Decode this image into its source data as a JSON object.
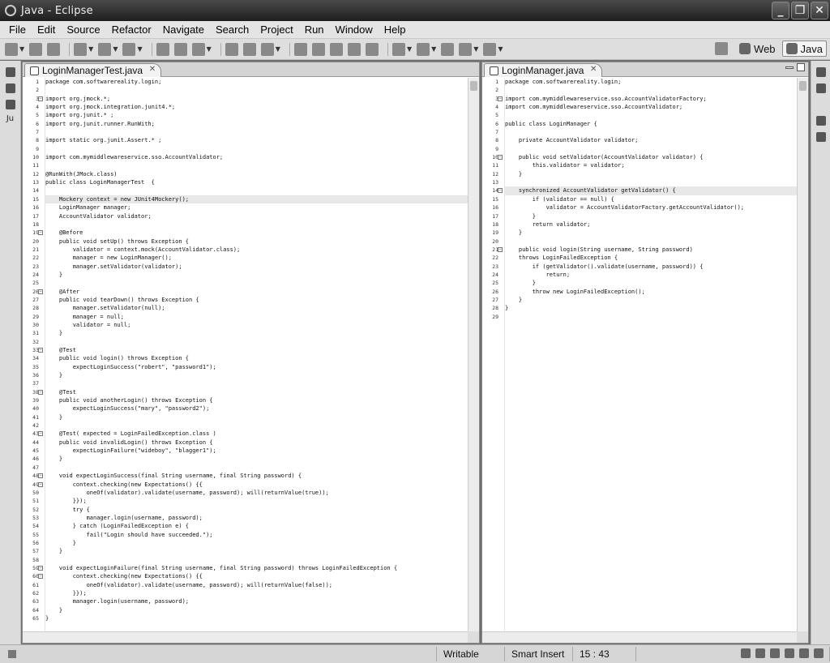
{
  "window": {
    "title": "Java - Eclipse",
    "buttons": [
      "_",
      "❐",
      "✕"
    ]
  },
  "menu": [
    "File",
    "Edit",
    "Source",
    "Refactor",
    "Navigate",
    "Search",
    "Project",
    "Run",
    "Window",
    "Help"
  ],
  "perspectives": [
    {
      "label": "Web",
      "active": false
    },
    {
      "label": "Java",
      "active": true
    }
  ],
  "left_strip": {
    "label": "Ju"
  },
  "left_editor": {
    "tab": "LoginManagerTest.java",
    "current_line": 15,
    "lines": [
      "package com.softwarereality.login;",
      "",
      "import org.jmock.*;",
      "import org.jmock.integration.junit4.*;",
      "import org.junit.* ;",
      "import org.junit.runner.RunWith;",
      "",
      "import static org.junit.Assert.* ;",
      "",
      "import com.mymiddlewareservice.sso.AccountValidator;",
      "",
      "@RunWith(JMock.class)",
      "public class LoginManagerTest  {",
      "",
      "    Mockery context = new JUnit4Mockery();",
      "    LoginManager manager;",
      "    AccountValidator validator;",
      "",
      "    @Before",
      "    public void setUp() throws Exception {",
      "        validator = context.mock(AccountValidator.class);",
      "        manager = new LoginManager();",
      "        manager.setValidator(validator);",
      "    }",
      "",
      "    @After",
      "    public void tearDown() throws Exception {",
      "        manager.setValidator(null);",
      "        manager = null;",
      "        validator = null;",
      "    }",
      "",
      "    @Test",
      "    public void login() throws Exception {",
      "        expectLoginSuccess(\"robert\", \"password1\");",
      "    }",
      "",
      "    @Test",
      "    public void anotherLogin() throws Exception {",
      "        expectLoginSuccess(\"mary\", \"password2\");",
      "    }",
      "",
      "    @Test( expected = LoginFailedException.class )",
      "    public void invalidLogin() throws Exception {",
      "        expectLoginFailure(\"wideboy\", \"blagger1\");",
      "    }",
      "",
      "    void expectLoginSuccess(final String username, final String password) {",
      "        context.checking(new Expectations() {{",
      "            oneOf(validator).validate(username, password); will(returnValue(true));",
      "        }});",
      "        try {",
      "            manager.login(username, password);",
      "        } catch (LoginFailedException e) {",
      "            fail(\"Login should have succeeded.\");",
      "        }",
      "    }",
      "",
      "    void expectLoginFailure(final String username, final String password) throws LoginFailedException {",
      "        context.checking(new Expectations() {{",
      "            oneOf(validator).validate(username, password); will(returnValue(false));",
      "        }});",
      "        manager.login(username, password);",
      "    }",
      "}"
    ]
  },
  "right_editor": {
    "tab": "LoginManager.java",
    "current_line": 14,
    "lines": [
      "package com.softwarereality.login;",
      "",
      "import com.mymiddlewareservice.sso.AccountValidatorFactory;",
      "import com.mymiddlewareservice.sso.AccountValidator;",
      "",
      "public class LoginManager {",
      "",
      "    private AccountValidator validator;",
      "",
      "    public void setValidator(AccountValidator validator) {",
      "        this.validator = validator;",
      "    }",
      "",
      "    synchronized AccountValidator getValidator() {",
      "        if (validator == null) {",
      "            validator = AccountValidatorFactory.getAccountValidator();",
      "        }",
      "        return validator;",
      "    }",
      "",
      "    public void login(String username, String password)",
      "    throws LoginFailedException {",
      "        if (getValidator().validate(username, password)) {",
      "            return;",
      "        }",
      "        throw new LoginFailedException();",
      "    }",
      "}",
      ""
    ]
  },
  "status": {
    "writable": "Writable",
    "insert_mode": "Smart Insert",
    "position": "15 : 43"
  }
}
